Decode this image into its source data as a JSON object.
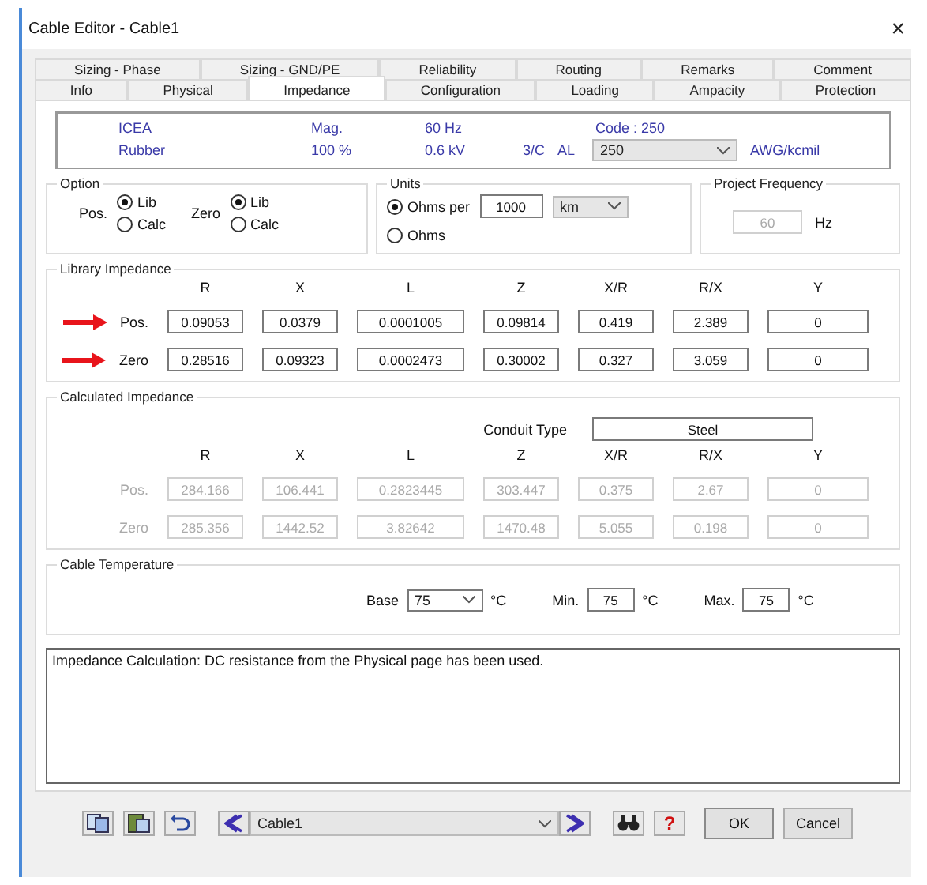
{
  "window": {
    "title": "Cable Editor - Cable1",
    "close": "×"
  },
  "tab_rows": [
    [
      {
        "label": "Sizing - Phase",
        "selected": false
      },
      {
        "label": "Sizing - GND/PE",
        "selected": false
      },
      {
        "label": "Reliability",
        "selected": false
      },
      {
        "label": "Routing",
        "selected": false
      },
      {
        "label": "Remarks",
        "selected": false
      },
      {
        "label": "Comment",
        "selected": false
      }
    ],
    [
      {
        "label": "Info",
        "selected": false
      },
      {
        "label": "Physical",
        "selected": false
      },
      {
        "label": "Impedance",
        "selected": true
      },
      {
        "label": "Configuration",
        "selected": false
      },
      {
        "label": "Loading",
        "selected": false
      },
      {
        "label": "Ampacity",
        "selected": false
      },
      {
        "label": "Protection",
        "selected": false
      }
    ]
  ],
  "header": {
    "standard": "ICEA",
    "insulation": "Rubber",
    "mag_label": "Mag.",
    "mag_value": "100 %",
    "frequency": "60 Hz",
    "voltage": "0.6 kV",
    "conductors": "3/C",
    "material": "AL",
    "code": "Code : 250",
    "size": "250",
    "size_unit": "AWG/kcmil"
  },
  "option": {
    "title": "Option",
    "groups": [
      {
        "label": "Pos.",
        "choices": [
          {
            "label": "Lib",
            "selected": true
          },
          {
            "label": "Calc",
            "selected": false
          }
        ]
      },
      {
        "label": "Zero",
        "choices": [
          {
            "label": "Lib",
            "selected": true
          },
          {
            "label": "Calc",
            "selected": false
          }
        ]
      }
    ]
  },
  "units": {
    "title": "Units",
    "choices": [
      {
        "label": "Ohms per",
        "selected": true
      },
      {
        "label": "Ohms",
        "selected": false
      }
    ],
    "length": "1000",
    "length_unit": "km"
  },
  "project_frequency": {
    "title": "Project Frequency",
    "value": "60",
    "unit": "Hz"
  },
  "library_impedance": {
    "title": "Library Impedance",
    "columns": [
      "R",
      "X",
      "L",
      "Z",
      "X/R",
      "R/X",
      "Y"
    ],
    "rows": [
      {
        "label": "Pos.",
        "marked": true,
        "disabled": false,
        "values": [
          "0.09053",
          "0.0379",
          "0.0001005",
          "0.09814",
          "0.419",
          "2.389",
          "0"
        ]
      },
      {
        "label": "Zero",
        "marked": true,
        "disabled": false,
        "values": [
          "0.28516",
          "0.09323",
          "0.0002473",
          "0.30002",
          "0.327",
          "3.059",
          "0"
        ]
      }
    ]
  },
  "calculated_impedance": {
    "title": "Calculated Impedance",
    "conduit_label": "Conduit Type",
    "conduit_type": "Steel",
    "columns": [
      "R",
      "X",
      "L",
      "Z",
      "X/R",
      "R/X",
      "Y"
    ],
    "rows": [
      {
        "label": "Pos.",
        "marked": false,
        "disabled": true,
        "values": [
          "284.166",
          "106.441",
          "0.2823445",
          "303.447",
          "0.375",
          "2.67",
          "0"
        ]
      },
      {
        "label": "Zero",
        "marked": false,
        "disabled": true,
        "values": [
          "285.356",
          "1442.52",
          "3.82642",
          "1470.48",
          "5.055",
          "0.198",
          "0"
        ]
      }
    ]
  },
  "cable_temperature": {
    "title": "Cable Temperature",
    "base_label": "Base",
    "base": "75",
    "min_label": "Min.",
    "min": "75",
    "max_label": "Max.",
    "max": "75",
    "base_unit": "°C",
    "min_unit": "°C",
    "max_unit": "°C"
  },
  "message": "Impedance Calculation: DC resistance from the Physical page has been used.",
  "footer": {
    "cable": "Cable1",
    "help": "?",
    "buttons": [
      "OK",
      "Cancel"
    ]
  }
}
